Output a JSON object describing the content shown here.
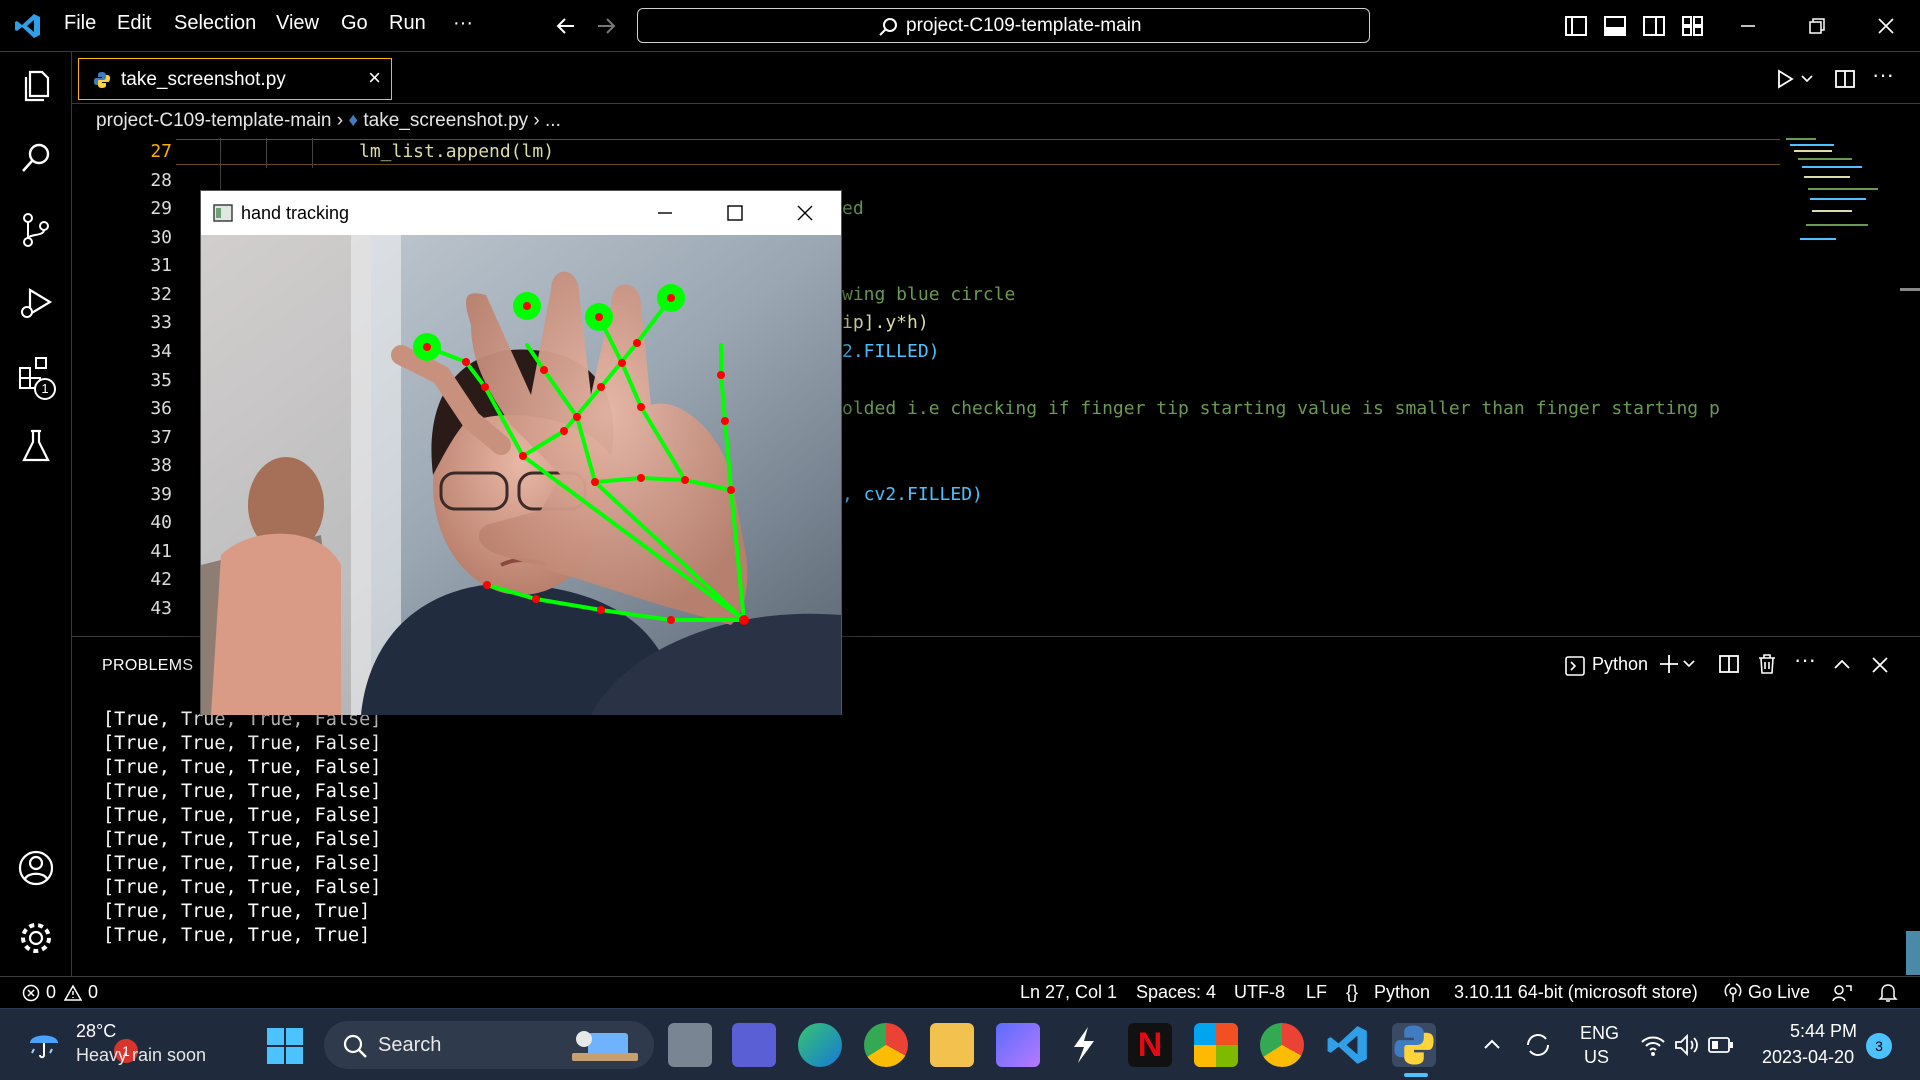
{
  "titlebar": {
    "menus": [
      "File",
      "Edit",
      "Selection",
      "View",
      "Go",
      "Run",
      "···"
    ],
    "search_text": "project-C109-template-main"
  },
  "activity_badge": "1",
  "tab": {
    "label": "take_screenshot.py"
  },
  "breadcrumb": {
    "folder": "project-C109-template-main",
    "file": "take_screenshot.py",
    "more": "..."
  },
  "editor": {
    "line_numbers": [
      "27",
      "28",
      "29",
      "30",
      "31",
      "32",
      "33",
      "34",
      "35",
      "36",
      "37",
      "38",
      "39",
      "40",
      "41",
      "42",
      "43"
    ],
    "lines": [
      {
        "line": "27",
        "text": "lm_list.append(lm)"
      },
      {
        "line": "29",
        "text": "ed"
      },
      {
        "line": "32",
        "text": "wing blue circle"
      },
      {
        "line": "33",
        "text": "ip].y*h)"
      },
      {
        "line": "34",
        "text": "2.FILLED)"
      },
      {
        "line": "36",
        "text": "olded i.e checking if finger tip starting value is smaller than finger starting p"
      },
      {
        "line": "39",
        "text": ", cv2.FILLED)"
      }
    ]
  },
  "panel": {
    "tab_label": "PROBLEMS",
    "terminal_label": "Python",
    "output": [
      "[True, True, True, False]",
      "[True, True, True, False]",
      "[True, True, True, False]",
      "[True, True, True, False]",
      "[True, True, True, False]",
      "[True, True, True, False]",
      "[True, True, True, False]",
      "[True, True, True, False]",
      "[True, True, True, True]",
      "[True, True, True, True]"
    ]
  },
  "cam_window": {
    "title": "hand tracking"
  },
  "status": {
    "errors": "0",
    "warnings": "0",
    "position": "Ln 27, Col 1",
    "spaces": "Spaces: 4",
    "encoding": "UTF-8",
    "eol": "LF",
    "language": "Python",
    "interpreter": "3.10.11 64-bit (microsoft store)",
    "golive": "Go Live"
  },
  "taskbar": {
    "weather_temp": "28°C",
    "weather_desc": "Heavy rain soon",
    "weather_badge": "1",
    "search_label": "Search",
    "lang_top": "ENG",
    "lang_bottom": "US",
    "time": "5:44 PM",
    "date": "2023-04-20",
    "notif_count": "3"
  },
  "colors": {
    "accent": "#ffb700",
    "comment": "#6a9955",
    "keyword_yellow": "#dcdcaa",
    "landmark_green": "#00ff00",
    "landmark_red": "#ff0000"
  }
}
